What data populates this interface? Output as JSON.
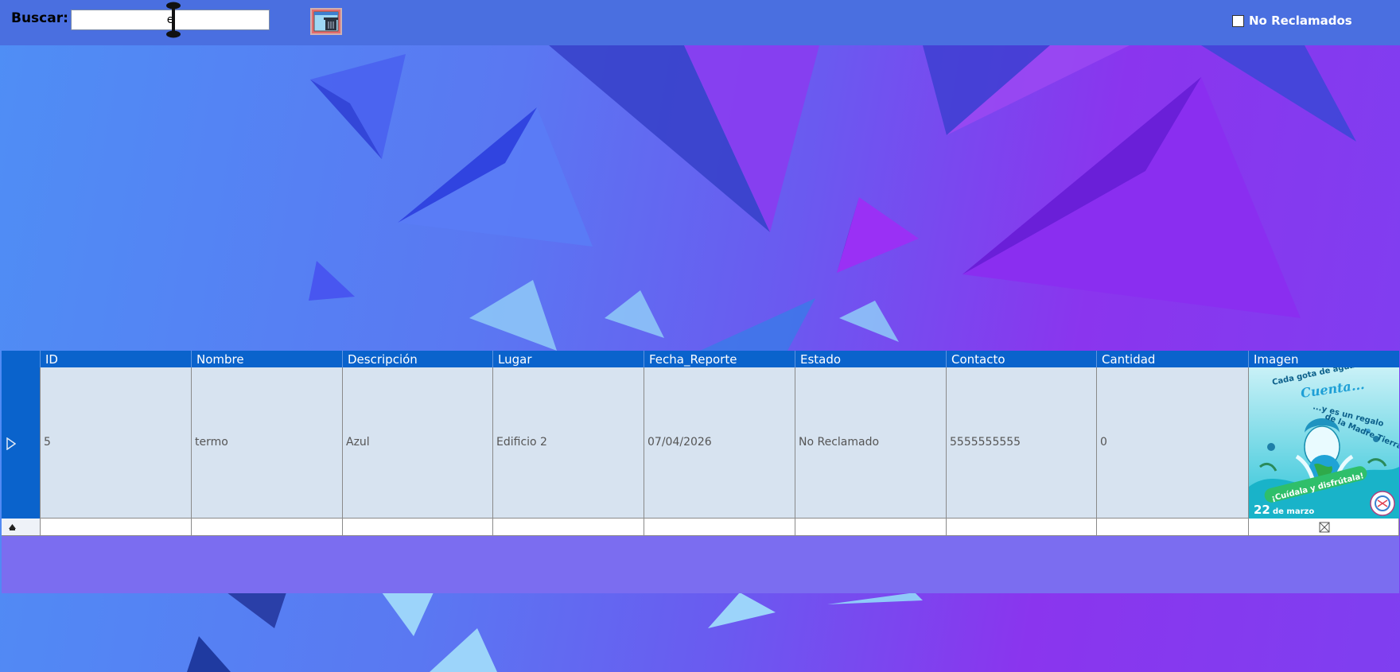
{
  "colors": {
    "topbar": "#4a6fe0",
    "grid_header": "#0a63cc",
    "grid_row": "#d7e3f0",
    "grid_bg": "#7b6df0"
  },
  "toolbar": {
    "search_label": "Buscar:",
    "search_value": "e",
    "search_placeholder": "",
    "clear_button_icon": "trash-image-icon",
    "checkbox_label": "No Reclamados",
    "checkbox_checked": false
  },
  "grid": {
    "columns": [
      "ID",
      "Nombre",
      "Descripción",
      "Lugar",
      "Fecha_Reporte",
      "Estado",
      "Contacto",
      "Cantidad",
      "Imagen"
    ],
    "rows": [
      {
        "id": "5",
        "nombre": "termo",
        "descripcion": "Azul",
        "lugar": "Edificio 2",
        "fecha_reporte": "07/04/2026",
        "estado": "No Reclamado",
        "contacto": "5555555555",
        "cantidad": "0",
        "imagen": {
          "line1": "Cada gota de agua",
          "line2": "Cuenta...",
          "line3": "...y es un regalo",
          "line4": "de la Madre Tierra.",
          "banner": "¡Cuídala y disfrútala!",
          "date_day": "22",
          "date_rest": "de marzo"
        }
      }
    ],
    "new_row_image_icon": "broken-image-icon",
    "selected_row_icon": "row-pointer-icon",
    "new_row_icon": "new-row-icon"
  }
}
